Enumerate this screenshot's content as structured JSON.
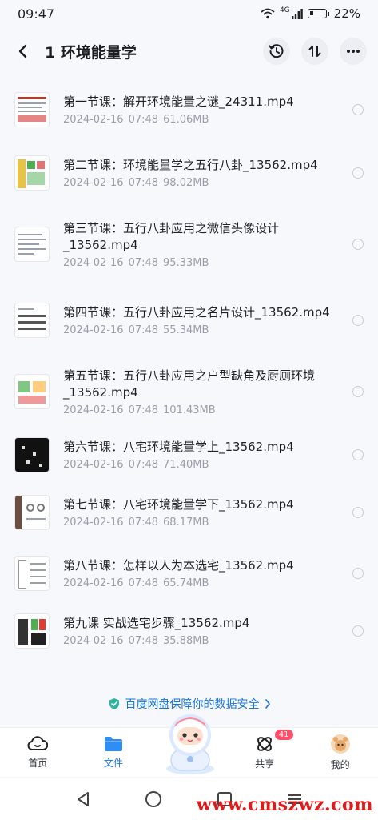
{
  "status": {
    "time": "09:47",
    "network": "4G",
    "battery": "22%"
  },
  "header": {
    "title": "1 环境能量学"
  },
  "files": [
    {
      "name": "第一节课：解开环境能量之谜_24311.mp4",
      "date": "2024-02-16",
      "time": "07:48",
      "size": "61.06MB"
    },
    {
      "name": "第二节课：环境能量学之五行八卦_13562.mp4",
      "date": "2024-02-16",
      "time": "07:48",
      "size": "98.02MB"
    },
    {
      "name": "第三节课：五行八卦应用之微信头像设计_13562.mp4",
      "date": "2024-02-16",
      "time": "07:48",
      "size": "95.33MB"
    },
    {
      "name": "第四节课：五行八卦应用之名片设计_13562.mp4",
      "date": "2024-02-16",
      "time": "07:48",
      "size": "55.34MB"
    },
    {
      "name": "第五节课：五行八卦应用之户型缺角及厨厕环境_13562.mp4",
      "date": "2024-02-16",
      "time": "07:48",
      "size": "101.43MB"
    },
    {
      "name": "第六节课：八宅环境能量学上_13562.mp4",
      "date": "2024-02-16",
      "time": "07:48",
      "size": "71.40MB"
    },
    {
      "name": "第七节课：八宅环境能量学下_13562.mp4",
      "date": "2024-02-16",
      "time": "07:48",
      "size": "68.17MB"
    },
    {
      "name": "第八节课：怎样以人为本选宅_13562.mp4",
      "date": "2024-02-16",
      "time": "07:48",
      "size": "65.74MB"
    },
    {
      "name": "第九课 实战选宅步骤_13562.mp4",
      "date": "2024-02-16",
      "time": "07:48",
      "size": "35.88MB"
    }
  ],
  "security": {
    "text": "百度网盘保障你的数据安全"
  },
  "nav": {
    "home": "首页",
    "files": "文件",
    "share": "共享",
    "share_badge": "41",
    "mine": "我的"
  },
  "watermark": "www.cmszwz.com",
  "colors": {
    "accent": "#1a73e8",
    "badge": "#ff4d6a",
    "watermark": "#e01b1b"
  }
}
